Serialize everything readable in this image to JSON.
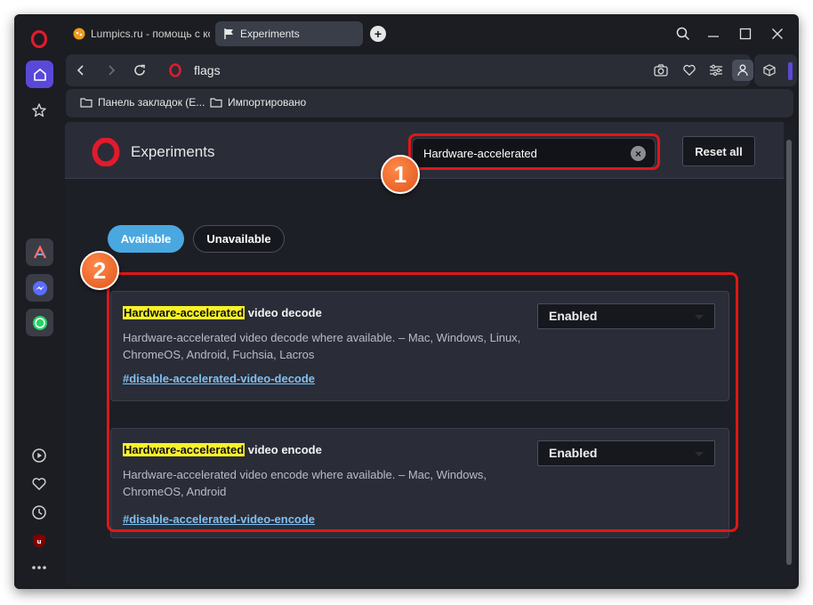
{
  "browser": {
    "tabs": [
      {
        "label": "Lumpics.ru - помощь с ко",
        "active": false
      },
      {
        "label": "Experiments",
        "active": true
      }
    ],
    "url": "flags",
    "bookmarks": [
      {
        "label": "Панель закладок (E..."
      },
      {
        "label": "Импортировано"
      }
    ]
  },
  "page": {
    "title": "Experiments",
    "search_value": "Hardware-accelerated",
    "reset_label": "Reset all",
    "tabs": {
      "available": "Available",
      "unavailable": "Unavailable"
    },
    "flags": [
      {
        "highlight": "Hardware-accelerated",
        "title_rest": " video decode",
        "description": "Hardware-accelerated video decode where available. – Mac, Windows, Linux, ChromeOS, Android, Fuchsia, Lacros",
        "link": "#disable-accelerated-video-decode",
        "value": "Enabled"
      },
      {
        "highlight": "Hardware-accelerated",
        "title_rest": " video encode",
        "description": "Hardware-accelerated video encode where available. – Mac, Windows, ChromeOS, Android",
        "link": "#disable-accelerated-video-encode",
        "value": "Enabled"
      }
    ]
  },
  "annotations": {
    "badge1": "1",
    "badge2": "2"
  },
  "colors": {
    "accent": "#5a49d8",
    "highlight": "#f8f12a",
    "annotation_red": "#e01717",
    "badge": "#e0551c",
    "pill_blue": "#4aa8e0",
    "link": "#7fc0f0"
  },
  "icons": [
    "opera-logo-icon",
    "home-icon",
    "star-icon",
    "aria-icon",
    "messenger-icon",
    "whatsapp-icon",
    "player-icon",
    "heart-icon",
    "history-icon",
    "ublock-icon",
    "more-icon",
    "search-icon",
    "minimize-icon",
    "maximize-icon",
    "close-icon",
    "back-icon",
    "forward-icon",
    "reload-icon",
    "camera-icon",
    "easy-setup-icon",
    "profile-icon",
    "cube-icon",
    "folder-icon"
  ]
}
